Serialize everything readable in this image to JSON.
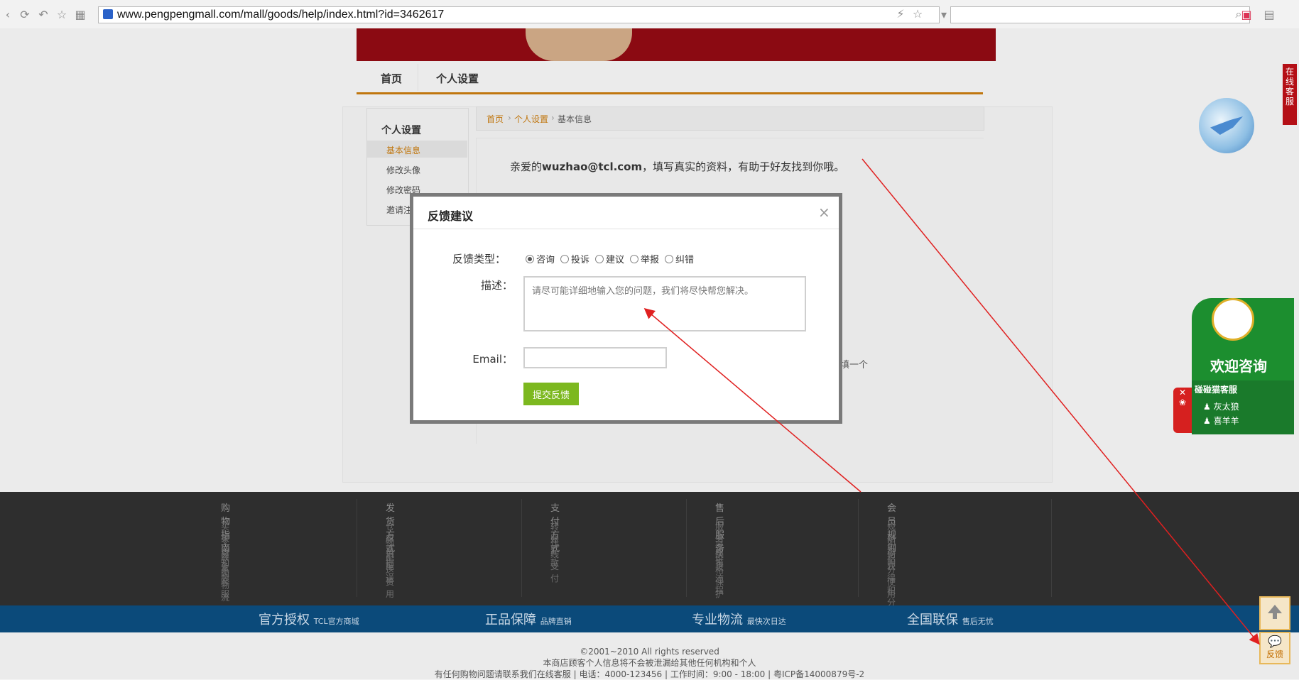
{
  "browser": {
    "url": "www.pengpengmall.com/mall/goods/help/index.html?id=3462617"
  },
  "nav": {
    "home": "首页",
    "personal": "个人设置"
  },
  "sidebar": {
    "title": "个人设置",
    "items": [
      {
        "label": "基本信息",
        "active": true
      },
      {
        "label": "修改头像"
      },
      {
        "label": "修改密码"
      },
      {
        "label": "邀请注"
      }
    ]
  },
  "breadcrumb": {
    "home": "首页",
    "personal": "个人设置",
    "current": "基本信息",
    "sep": "›"
  },
  "content": {
    "greeting_pre": "亲爱的",
    "email": "wuzhao@tcl.com",
    "greeting_post": "，填写真实的资料，有助于好友找到你哦。",
    "fragment_right": "选填一个"
  },
  "modal": {
    "title": "反馈建议",
    "close": "×",
    "type_label": "反馈类型：",
    "types": [
      "咨询",
      "投诉",
      "建议",
      "举报",
      "纠错"
    ],
    "selected_type": "咨询",
    "desc_label": "描述：",
    "desc_placeholder": "请尽可能详细地输入您的问题，我们将尽快帮您解决。",
    "email_label": "Email：",
    "email_value": "",
    "submit": "提交反馈"
  },
  "footer": {
    "columns": [
      {
        "title": "购物指南",
        "items": [
          "买家须知",
          "交易条款",
          "联系客服",
          "购物流程"
        ]
      },
      {
        "title": "发货方式",
        "items": [
          "仓库自提",
          "物流配送",
          "配送费用"
        ]
      },
      {
        "title": "支付方式",
        "items": [
          "转账汇款",
          "在线支付"
        ]
      },
      {
        "title": "售后服务",
        "items": [
          "服务政策",
          "退换货流程",
          "价格保护"
        ]
      },
      {
        "title": "会员规则",
        "items": [
          "规则说明",
          "如何获得积分",
          "积分使用"
        ]
      }
    ],
    "guarantees": [
      {
        "big": "官方授权",
        "small": "TCL官方商城"
      },
      {
        "big": "正品保障",
        "small": "品牌直销"
      },
      {
        "big": "专业物流",
        "small": "最快次日达"
      },
      {
        "big": "全国联保",
        "small": "售后无忧"
      }
    ],
    "copyright": "©2001~2010 All rights reserved",
    "privacy": "本商店顾客个人信息将不会被泄漏给其他任何机构和个人",
    "contact": "有任何购物问题请联系我们在线客服 | 电话：4000-123456 | 工作时间：9:00 - 18:00 | 粤ICP备14000879号-2"
  },
  "widgets": {
    "online_service": "在线客服",
    "welcome": "欢迎咨询",
    "service_title": "碰碰猫客服",
    "agents": [
      "灰太狼",
      "喜羊羊"
    ],
    "feedback": "反馈"
  }
}
